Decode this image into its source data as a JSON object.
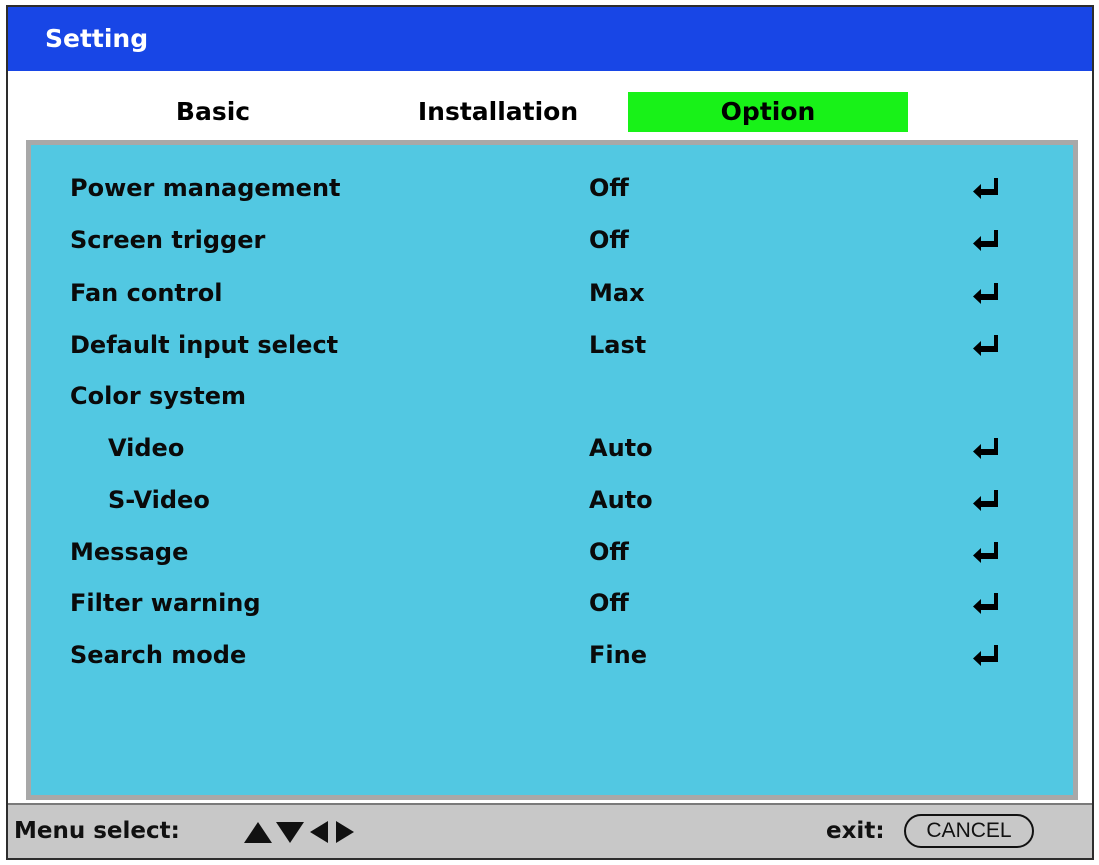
{
  "window": {
    "title": "Setting"
  },
  "tabs": [
    {
      "label": "Basic",
      "active": false
    },
    {
      "label": "Installation",
      "active": false
    },
    {
      "label": "Option",
      "active": true
    }
  ],
  "rows": [
    {
      "label": "Power management",
      "value": "Off",
      "indent": false,
      "icon": "enter-icon"
    },
    {
      "label": "Screen trigger",
      "value": "Off",
      "indent": false,
      "icon": "enter-icon"
    },
    {
      "label": "Fan control",
      "value": "Max",
      "indent": false,
      "icon": "enter-icon"
    },
    {
      "label": "Default input select",
      "value": "Last",
      "indent": false,
      "icon": "enter-icon"
    },
    {
      "label": "Color system",
      "value": "",
      "indent": false,
      "icon": ""
    },
    {
      "label": "Video",
      "value": "Auto",
      "indent": true,
      "icon": "enter-icon"
    },
    {
      "label": "S-Video",
      "value": "Auto",
      "indent": true,
      "icon": "enter-icon"
    },
    {
      "label": "Message",
      "value": "Off",
      "indent": false,
      "icon": "enter-icon"
    },
    {
      "label": "Filter warning",
      "value": "Off",
      "indent": false,
      "icon": "enter-icon"
    },
    {
      "label": "Search mode",
      "value": "Fine",
      "indent": false,
      "icon": "enter-icon"
    }
  ],
  "footer": {
    "menu_select_label": "Menu select:",
    "arrows_icon": "arrow-keys-icon",
    "exit_label": "exit:",
    "cancel_label": "CANCEL"
  },
  "colors": {
    "title_bar": "#1846e6",
    "active_tab": "#18f218",
    "panel": "#52c8e2",
    "panel_border": "#a8a8a8",
    "footer": "#c8c8c8"
  }
}
